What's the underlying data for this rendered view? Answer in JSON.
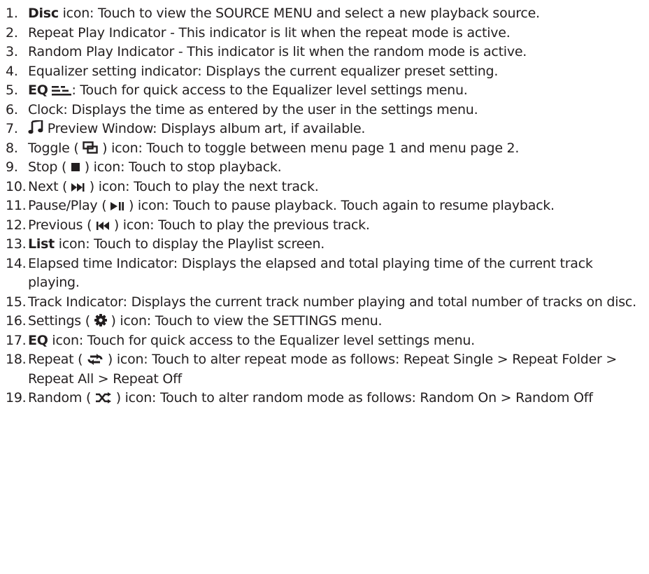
{
  "items": [
    {
      "number": "1.",
      "bold": "Disc",
      "text": " icon: Touch to view the SOURCE MENU and select a new playback source."
    },
    {
      "number": "2.",
      "text": "Repeat Play Indicator - This indicator is lit when the repeat mode is active."
    },
    {
      "number": "3.",
      "text": "Random Play Indicator - This indicator is lit when the random mode is active."
    },
    {
      "number": "4.",
      "text": "Equalizer setting indicator: Displays the current equalizer preset setting."
    },
    {
      "number": "5.",
      "bold": "EQ",
      "icon": "eq-bars-icon",
      "text": ": Touch for quick access to the Equalizer level settings menu."
    },
    {
      "number": "6.",
      "text": "Clock: Displays the time as entered by the user in the settings menu."
    },
    {
      "number": "7.",
      "icon": "music-note-icon",
      "text": " Preview Window: Displays album art, if available."
    },
    {
      "number": "8.",
      "pre": "Toggle ( ",
      "icon": "toggle-pages-icon",
      "text": " ) icon: Touch to toggle between menu page 1 and menu page 2."
    },
    {
      "number": "9.",
      "pre": "Stop ( ",
      "icon": "stop-icon",
      "text": " ) icon: Touch to stop playback."
    },
    {
      "number": "10.",
      "pre": "Next ( ",
      "icon": "next-track-icon",
      "text": " ) icon: Touch to play the next track."
    },
    {
      "number": "11.",
      "pre": "Pause/Play ( ",
      "icon": "play-pause-icon",
      "text": " ) icon: Touch to pause playback. Touch again to resume playback."
    },
    {
      "number": "12.",
      "pre": "Previous ( ",
      "icon": "previous-track-icon",
      "text": " ) icon: Touch to play the previous track."
    },
    {
      "number": "13.",
      "bold": "List",
      "text": " icon: Touch to display the Playlist screen."
    },
    {
      "number": "14.",
      "text": "Elapsed time Indicator: Displays the elapsed and total playing time of the current track playing."
    },
    {
      "number": "15.",
      "text": "Track Indicator: Displays the current track number playing and total number of tracks on disc."
    },
    {
      "number": "16.",
      "pre": "Settings ( ",
      "icon": "gear-icon",
      "text": " ) icon: Touch to view the SETTINGS menu."
    },
    {
      "number": "17.",
      "bold": "EQ",
      "text": " icon: Touch for quick access to the Equalizer level settings menu."
    },
    {
      "number": "18.",
      "pre": "Repeat ( ",
      "icon": "repeat-icon",
      "text": " ) icon: Touch to alter repeat mode as follows: Repeat Single > Repeat Folder > Repeat All > Repeat Off"
    },
    {
      "number": "19.",
      "pre": "Random ( ",
      "icon": "shuffle-icon",
      "text": " ) icon: Touch to alter random mode as follows: Random On > Random Off"
    }
  ]
}
